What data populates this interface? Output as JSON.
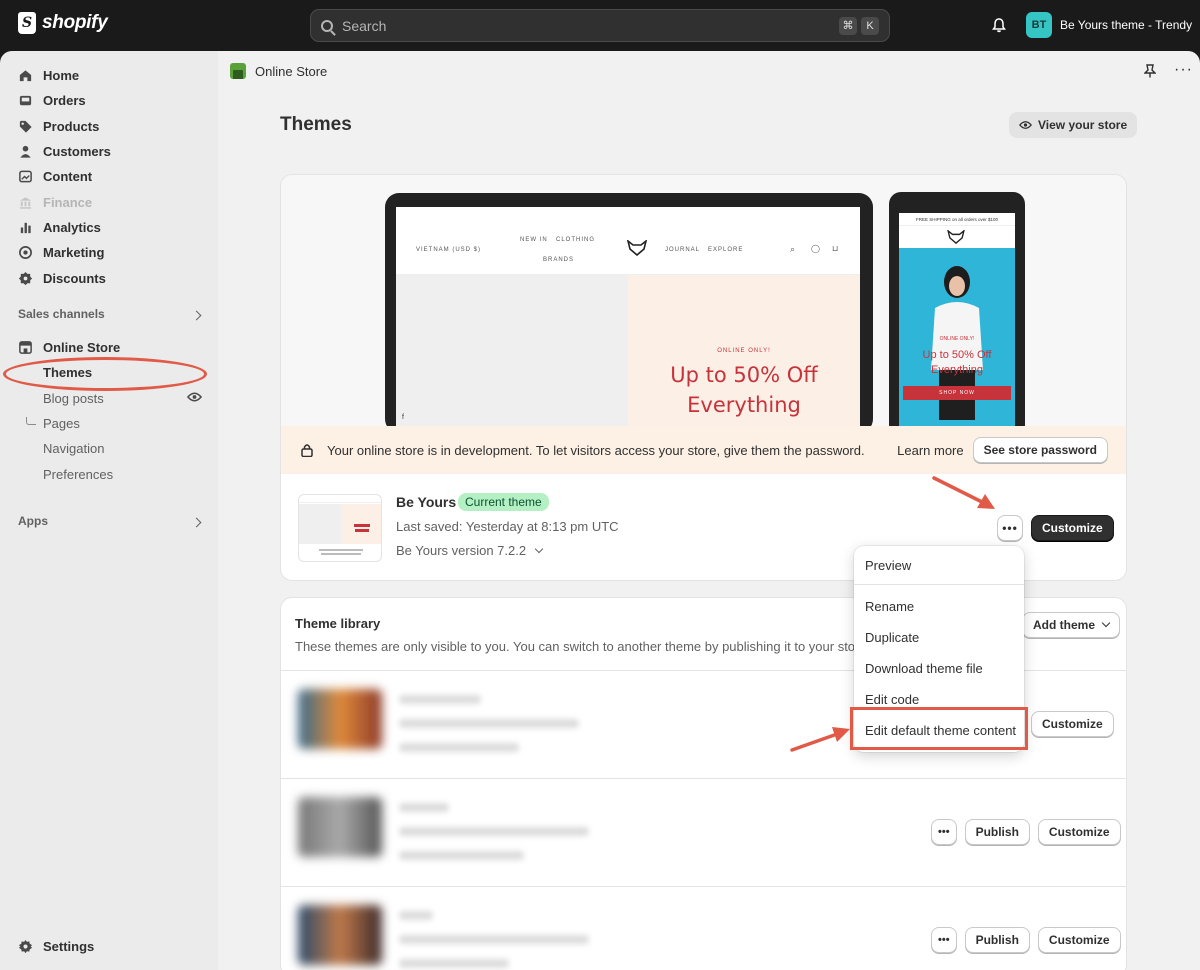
{
  "topbar": {
    "logo_text": "shopify",
    "search_placeholder": "Search",
    "shortcut_keys": [
      "⌘",
      "K"
    ],
    "store_initials": "BT",
    "store_name": "Be Yours theme - Trendy"
  },
  "sidebar": {
    "items": [
      {
        "label": "Home",
        "icon": "home-icon"
      },
      {
        "label": "Orders",
        "icon": "inbox-icon"
      },
      {
        "label": "Products",
        "icon": "tag-icon"
      },
      {
        "label": "Customers",
        "icon": "person-icon"
      },
      {
        "label": "Content",
        "icon": "image-icon"
      },
      {
        "label": "Finance",
        "icon": "bank-icon",
        "disabled": true
      },
      {
        "label": "Analytics",
        "icon": "bar-chart-icon"
      },
      {
        "label": "Marketing",
        "icon": "target-icon"
      },
      {
        "label": "Discounts",
        "icon": "gear-badge-icon"
      }
    ],
    "sales_channels_label": "Sales channels",
    "online_store_label": "Online Store",
    "sub_items": [
      "Themes",
      "Blog posts",
      "Pages",
      "Navigation",
      "Preferences"
    ],
    "apps_label": "Apps",
    "settings_label": "Settings"
  },
  "main": {
    "breadcrumb": "Online Store",
    "page_title": "Themes",
    "view_store_label": "View your store",
    "preview": {
      "laptop_currency": "VIETNAM (USD $)",
      "laptop_nav": [
        "NEW IN",
        "CLOTHING",
        "BRANDS",
        "JOURNAL",
        "EXPLORE"
      ],
      "online_only": "ONLINE ONLY!",
      "promo_line1": "Up to 50% Off",
      "promo_line2": "Everything",
      "phone_bar": "FREE SHIPPING on all orders over $100",
      "phone_online": "ONLINE ONLY!",
      "phone_promo1": "Up to 50% Off",
      "phone_promo2": "Everything",
      "phone_cta": "SHOP NOW"
    },
    "dev_banner": {
      "text": "Your online store is in development. To let visitors access your store, give them the password.",
      "learn_more": "Learn more",
      "button": "See store password"
    },
    "current_theme": {
      "name": "Be Yours",
      "badge": "Current theme",
      "last_saved": "Last saved: Yesterday at 8:13 pm UTC",
      "version": "Be Yours version 7.2.2",
      "more_label": "•••",
      "customize_label": "Customize"
    },
    "library": {
      "title": "Theme library",
      "description": "These themes are only visible to you. You can switch to another theme by publishing it to your store.",
      "add_theme_label": "Add theme",
      "more_label": "•••",
      "publish_label": "Publish",
      "customize_label": "Customize"
    }
  },
  "dropdown": {
    "items": [
      "Preview",
      "Rename",
      "Duplicate",
      "Download theme file",
      "Edit code",
      "Edit default theme content"
    ]
  },
  "colors": {
    "accent": "#e05a47",
    "badge_bg": "#b4f0c3",
    "banner_bg": "#fdf0e4",
    "promo_red": "#c7333a"
  }
}
